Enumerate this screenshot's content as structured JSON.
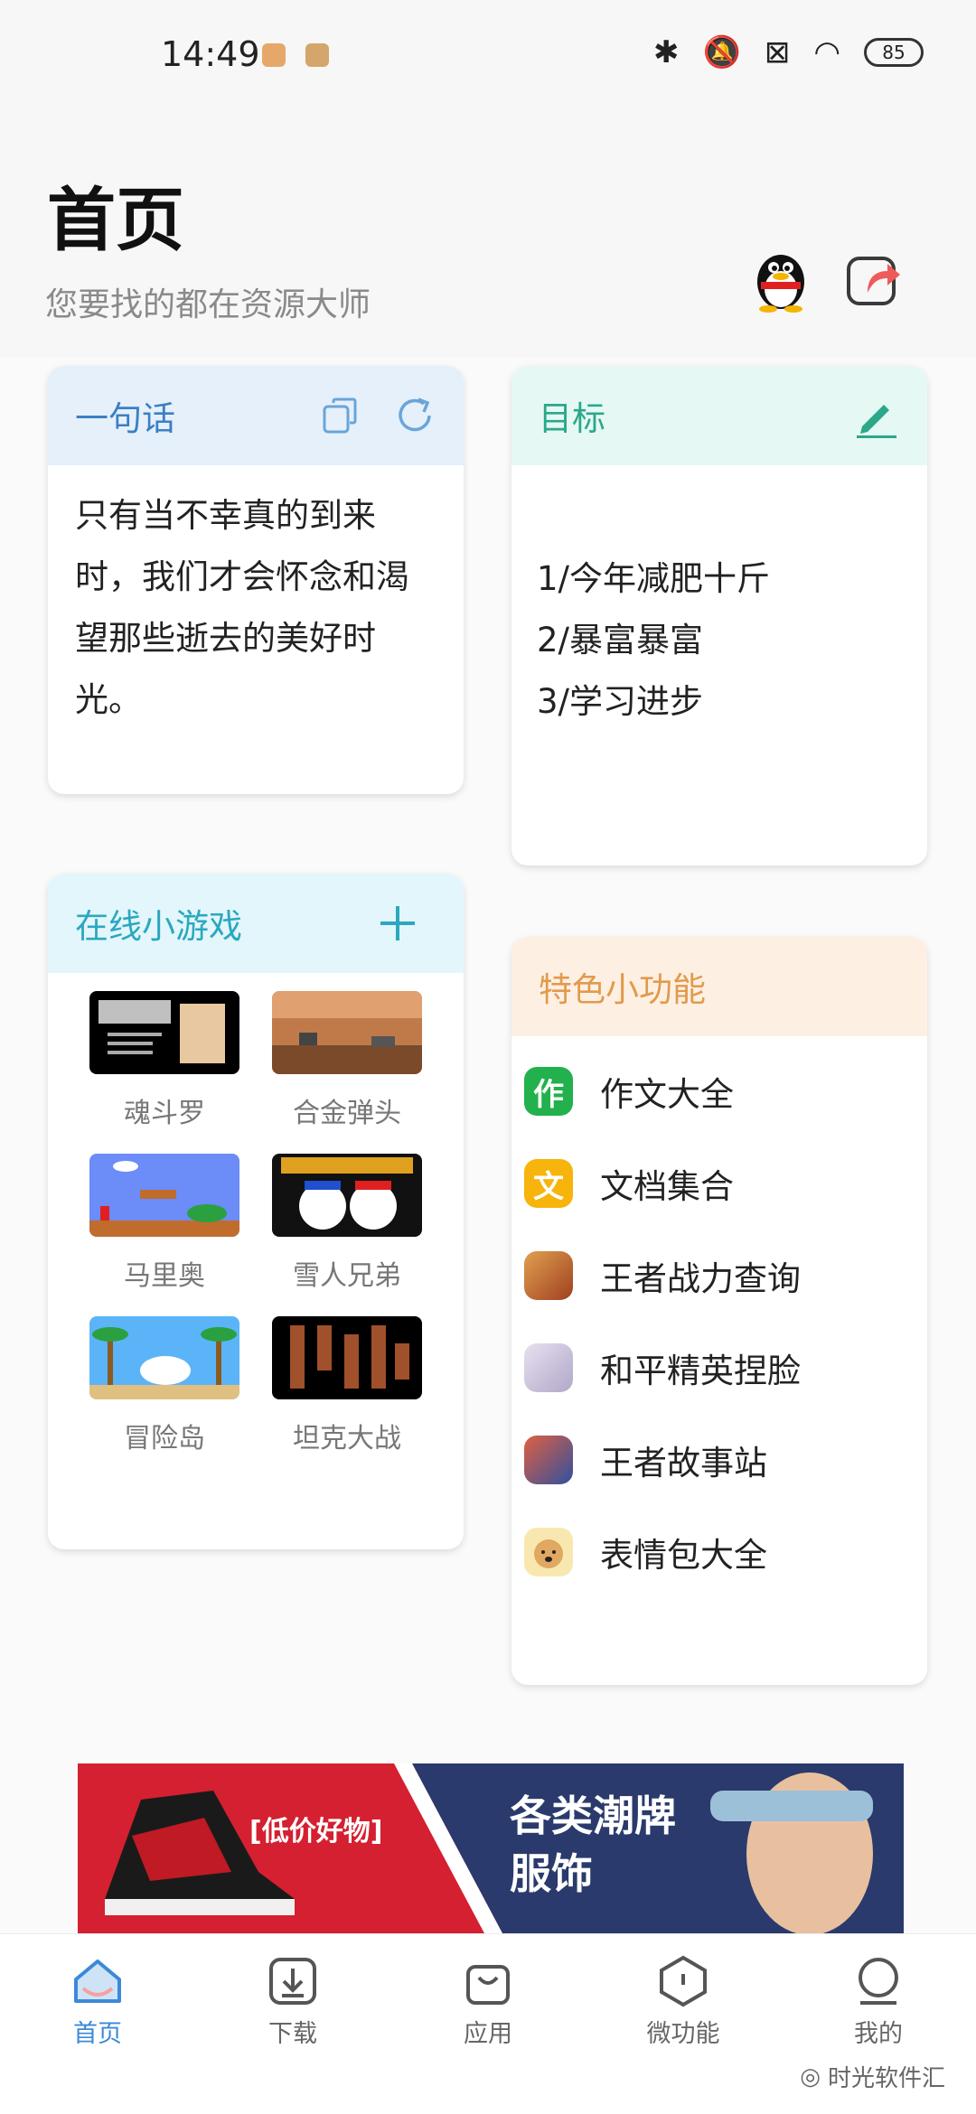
{
  "status_bar": {
    "time": "14:49",
    "battery": "85"
  },
  "header": {
    "title": "首页",
    "subtitle": "您要找的都在资源大师"
  },
  "quote_card": {
    "title": "一句话",
    "text": "只有当不幸真的到来时，我们才会怀念和渴望那些逝去的美好时光。"
  },
  "goal_card": {
    "title": "目标",
    "items": [
      "1/今年减肥十斤",
      "2/暴富暴富",
      "3/学习进步"
    ]
  },
  "games_card": {
    "title": "在线小游戏",
    "games": [
      "魂斗罗",
      "合金弹头",
      "马里奥",
      "雪人兄弟",
      "冒险岛",
      "坦克大战"
    ]
  },
  "feature_card": {
    "title": "特色小功能",
    "items": [
      {
        "label": "作文大全",
        "icon": "作"
      },
      {
        "label": "文档集合",
        "icon": "文"
      },
      {
        "label": "王者战力查询",
        "icon": ""
      },
      {
        "label": "和平精英捏脸",
        "icon": ""
      },
      {
        "label": "王者故事站",
        "icon": ""
      },
      {
        "label": "表情包大全",
        "icon": ""
      }
    ]
  },
  "banner": {
    "left_text": "[低价好物]",
    "right_text_1": "各类潮牌",
    "right_text_2": "服饰"
  },
  "tabbar": {
    "items": [
      "首页",
      "下载",
      "应用",
      "微功能",
      "我的"
    ],
    "active": "首页"
  },
  "watermark": "时光软件汇",
  "colors": {
    "accent": "#3b8ad8",
    "quote_head": "#e5f0fb",
    "goal_head": "#e6f8f4",
    "games_head": "#e3f6fb",
    "feature_head": "#fdf0e3"
  }
}
